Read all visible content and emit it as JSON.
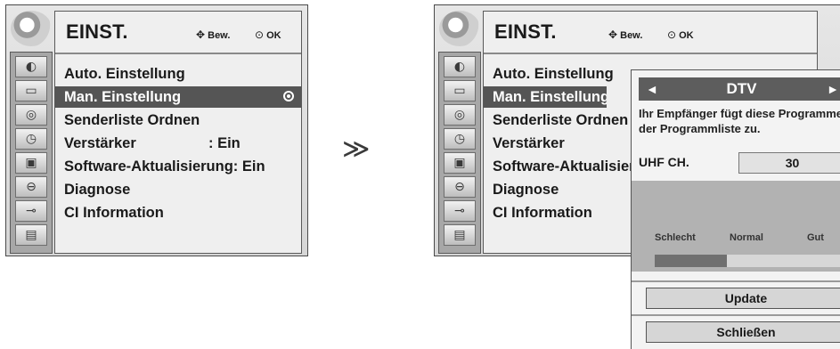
{
  "menu": {
    "title": "EINST.",
    "hint_move": "Bew.",
    "hint_ok": "OK",
    "items": [
      {
        "label": "Auto. Einstellung",
        "value": ""
      },
      {
        "label": "Man. Einstellung",
        "value": "",
        "selected": true
      },
      {
        "label": "Senderliste Ordnen",
        "value": ""
      },
      {
        "label": "Verstärker",
        "value": ": Ein"
      },
      {
        "label": "Software-Aktualisierung: Ein",
        "value": ""
      },
      {
        "label": "Diagnose",
        "value": ""
      },
      {
        "label": "CI Information",
        "value": ""
      }
    ],
    "side_icons": [
      "globe-icon",
      "monitor-icon",
      "speaker-icon",
      "clock-icon",
      "calendar-icon",
      "lock-icon",
      "connector-icon",
      "settings-icon"
    ]
  },
  "right_menu": {
    "items_truncated": [
      "Auto. Einstellung",
      "Man. Einstellung",
      "Senderliste Ordnen",
      "Verstärker",
      "Software-Aktualisier",
      "Diagnose",
      "CI Information"
    ]
  },
  "transition_symbol": "≫",
  "popup": {
    "mode": "DTV",
    "left_arrow": "◄",
    "right_arrow": "►",
    "message": "Ihr Empfänger fügt diese Programme der Programmliste zu.",
    "uhf_label": "UHF CH.",
    "uhf_value": "30",
    "signal_labels": [
      "Schlecht",
      "Normal",
      "Gut"
    ],
    "signal_level": 0.38,
    "update_label": "Update",
    "close_label": "Schließen"
  },
  "colors": {
    "selection": "#555555",
    "panel_bg": "#efefef",
    "signal_fill": "#707070"
  }
}
